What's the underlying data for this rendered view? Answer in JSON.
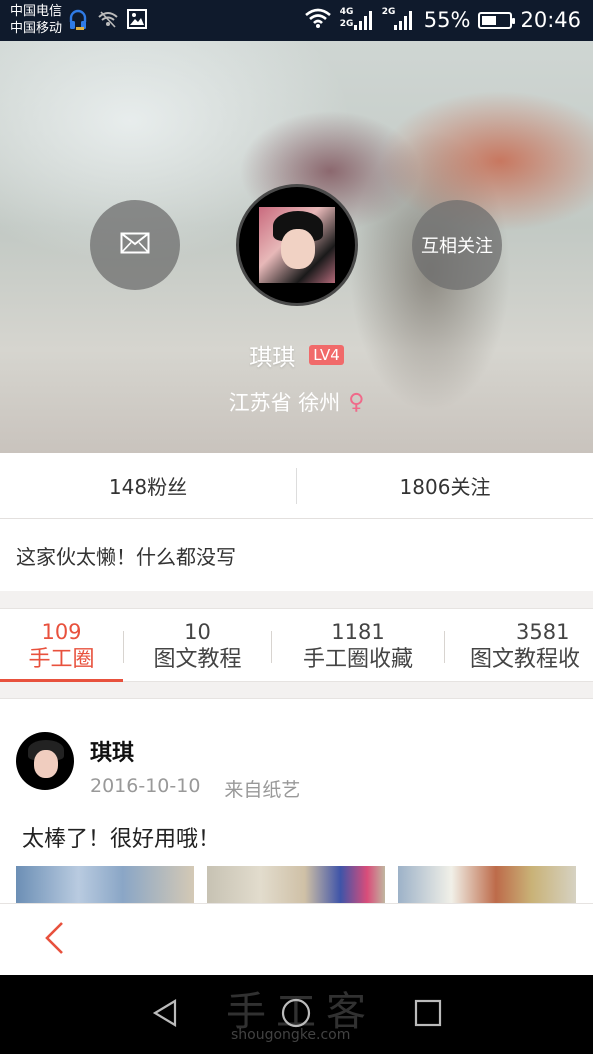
{
  "status_bar": {
    "carrier_1": "中国电信",
    "carrier_2": "中国移动",
    "net_1": "4G",
    "net_2": "2G",
    "net_3": "2G",
    "battery_percent": "55%",
    "battery_level": 0.55,
    "time": "20:46",
    "icons": [
      "headset-icon",
      "wifi-off-icon",
      "image-icon",
      "wifi-icon",
      "signal-icon",
      "battery-icon"
    ]
  },
  "profile": {
    "name": "琪琪",
    "level": "LV4",
    "location": "江苏省 徐州",
    "gender_symbol": "♀",
    "follow_label": "互相关注",
    "message_icon": "mail-icon"
  },
  "stats": {
    "fans": "148粉丝",
    "following": "1806关注"
  },
  "bio": "这家伙太懒！什么都没写",
  "tabs": [
    {
      "count": "109",
      "label": "手工圈"
    },
    {
      "count": "10",
      "label": "图文教程"
    },
    {
      "count": "1181",
      "label": "手工圈收藏"
    },
    {
      "count": "3581",
      "label": "图文教程收"
    }
  ],
  "post": {
    "author": "琪琪",
    "date": "2016-10-10",
    "source": "来自纸艺",
    "text": "太棒了！很好用哦！"
  },
  "watermark": {
    "text": "手工客",
    "domain": "shougongke.com"
  },
  "colors": {
    "accent": "#e8513d",
    "level_badge": "#f16a6a",
    "gender": "#f06a8a",
    "status_bar": "#0f1a2c"
  }
}
